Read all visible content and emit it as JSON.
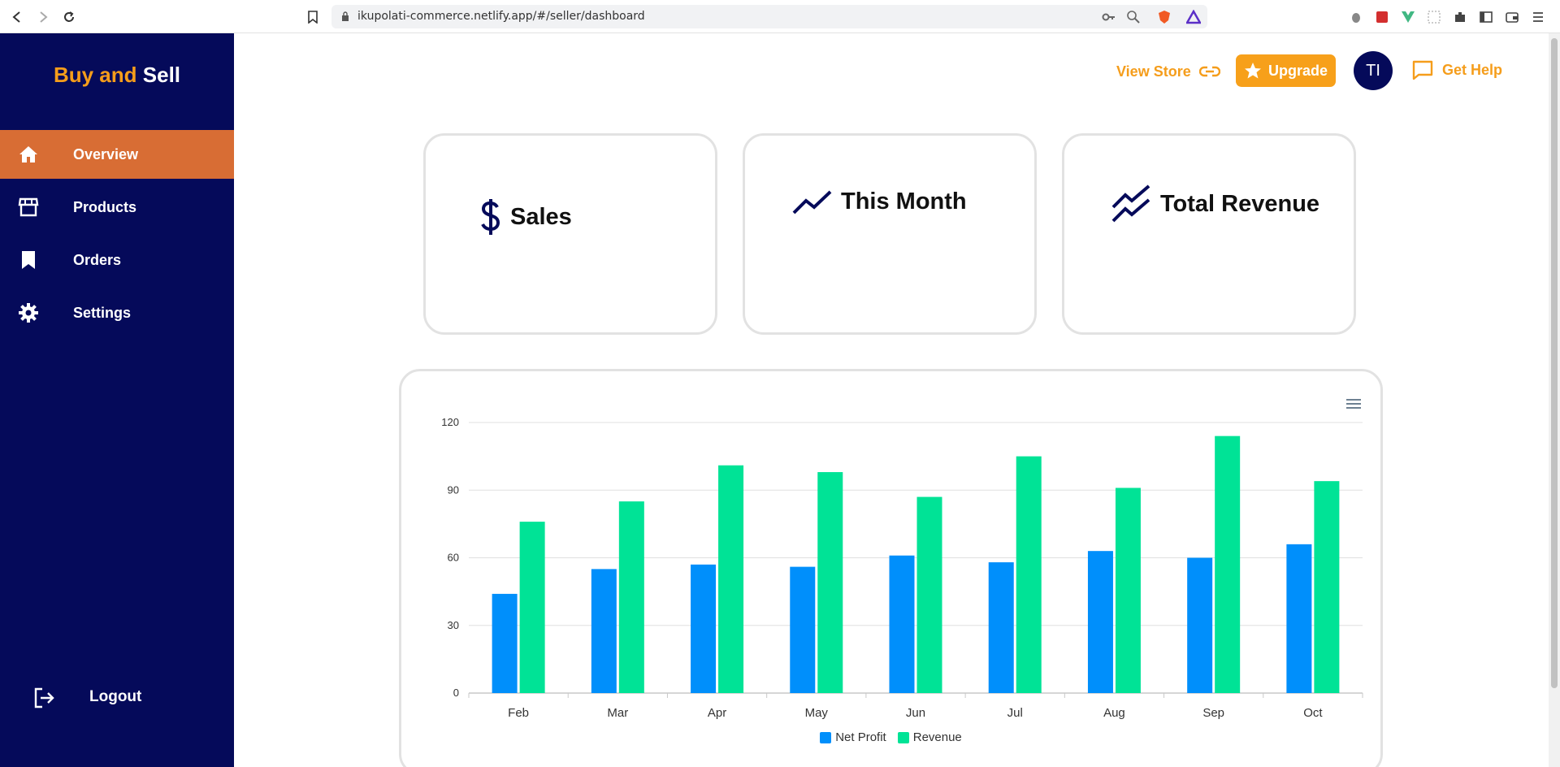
{
  "browser": {
    "url": "ikupolati-commerce.netlify.app/#/seller/dashboard"
  },
  "sidebar": {
    "brand_part1": "Buy and",
    "brand_part2": "Sell",
    "items": [
      {
        "label": "Overview",
        "icon": "home-icon",
        "active": true
      },
      {
        "label": "Products",
        "icon": "store-icon",
        "active": false
      },
      {
        "label": "Orders",
        "icon": "bookmark-icon",
        "active": false
      },
      {
        "label": "Settings",
        "icon": "gear-icon",
        "active": false
      }
    ],
    "logout_label": "Logout"
  },
  "topbar": {
    "view_store": "View Store",
    "upgrade": "Upgrade",
    "avatar_initials": "TI",
    "get_help": "Get Help"
  },
  "cards": [
    {
      "title": "Sales",
      "icon": "dollar-icon"
    },
    {
      "title": "This Month",
      "icon": "trend-up-icon"
    },
    {
      "title": "Total Revenue",
      "icon": "double-trend-icon"
    }
  ],
  "colors": {
    "sidebar_bg": "#050a5a",
    "active_nav": "#d86d34",
    "accent": "#f59d1b",
    "net_profit": "#008ffb",
    "revenue": "#00e396"
  },
  "chart_data": {
    "type": "bar",
    "categories": [
      "Feb",
      "Mar",
      "Apr",
      "May",
      "Jun",
      "Jul",
      "Aug",
      "Sep",
      "Oct"
    ],
    "series": [
      {
        "name": "Net Profit",
        "values": [
          44,
          55,
          57,
          56,
          61,
          58,
          63,
          60,
          66
        ]
      },
      {
        "name": "Revenue",
        "values": [
          76,
          85,
          101,
          98,
          87,
          105,
          91,
          114,
          94
        ]
      }
    ],
    "yticks": [
      "0",
      "30",
      "60",
      "90",
      "120"
    ],
    "ylim": [
      0,
      120
    ],
    "grid": true,
    "legend": "bottom-center"
  }
}
